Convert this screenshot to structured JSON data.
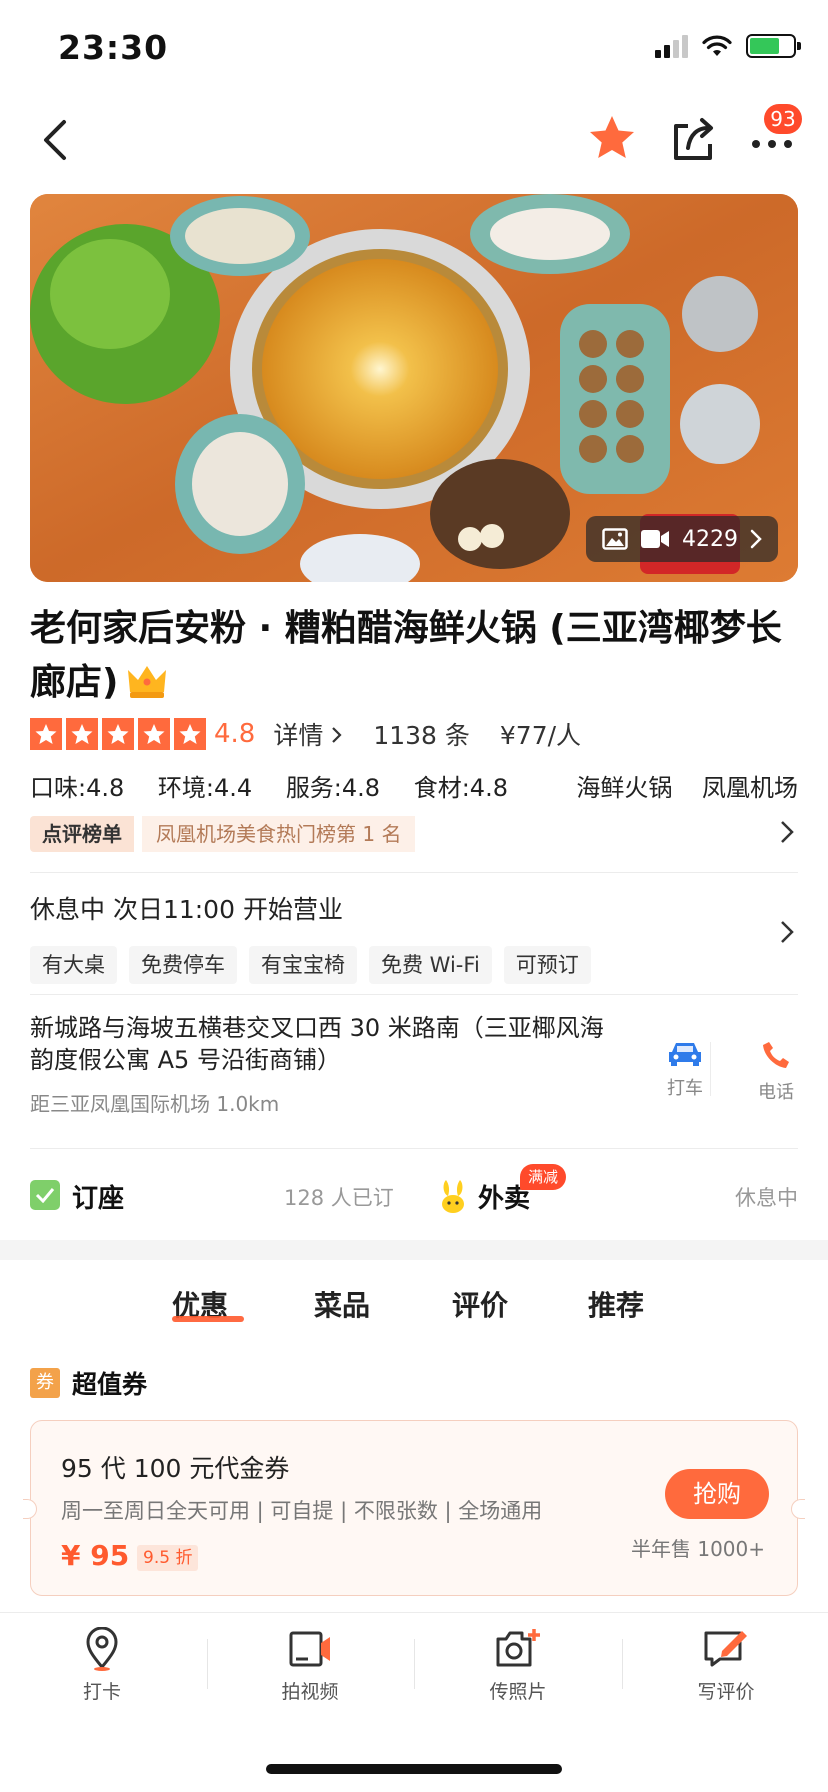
{
  "status_bar": {
    "time": "23:30"
  },
  "nav": {
    "more_badge": "93"
  },
  "hero": {
    "media_count": "4229"
  },
  "shop": {
    "title": "老何家后安粉 · 糟粕醋海鲜火锅 (三亚湾椰梦长廊店)",
    "rating": {
      "stars": 5,
      "score": "4.8",
      "detail_label": "详情",
      "review_count": "1138 条",
      "avg_price": "¥77/人"
    },
    "subscores": {
      "taste": "口味:4.8",
      "environment": "环境:4.4",
      "service": "服务:4.8",
      "ingredients": "食材:4.8"
    },
    "tags": [
      "海鲜火锅",
      "凤凰机场"
    ],
    "rank": {
      "label": "点评榜单",
      "text": "凤凰机场美食热门榜第 1 名"
    }
  },
  "hours": {
    "status": "休息中 次日11:00 开始营业",
    "facilities": [
      "有大桌",
      "免费停车",
      "有宝宝椅",
      "免费 Wi-Fi",
      "可预订"
    ]
  },
  "address": {
    "text": "新城路与海坡五横巷交叉口西 30 米路南（三亚椰风海韵度假公寓 A5 号沿街商铺）",
    "distance": "距三亚凤凰国际机场 1.0km",
    "taxi_label": "打车",
    "phone_label": "电话"
  },
  "booking": {
    "label": "订座",
    "count": "128 人已订",
    "takeout_label": "外卖",
    "takeout_badge": "满减",
    "takeout_status": "休息中"
  },
  "tabs": [
    "优惠",
    "菜品",
    "评价",
    "推荐"
  ],
  "coupon_section": {
    "icon_text": "券",
    "heading": "超值券",
    "card": {
      "title": "95 代 100 元代金券",
      "desc": "周一至周日全天可用 | 可自提 | 不限张数 | 全场通用",
      "price": "¥ 95",
      "discount": "9.5 折",
      "buy_label": "抢购",
      "sold": "半年售 1000+"
    }
  },
  "bottom_bar": [
    {
      "label": "打卡",
      "icon": "location-pin-icon"
    },
    {
      "label": "拍视频",
      "icon": "video-camera-icon"
    },
    {
      "label": "传照片",
      "icon": "photo-upload-icon"
    },
    {
      "label": "写评价",
      "icon": "write-review-icon"
    }
  ],
  "colors": {
    "accent": "#ff6a3d",
    "badge_red": "#ff4a2b",
    "star_orange": "#ff6a3d"
  }
}
